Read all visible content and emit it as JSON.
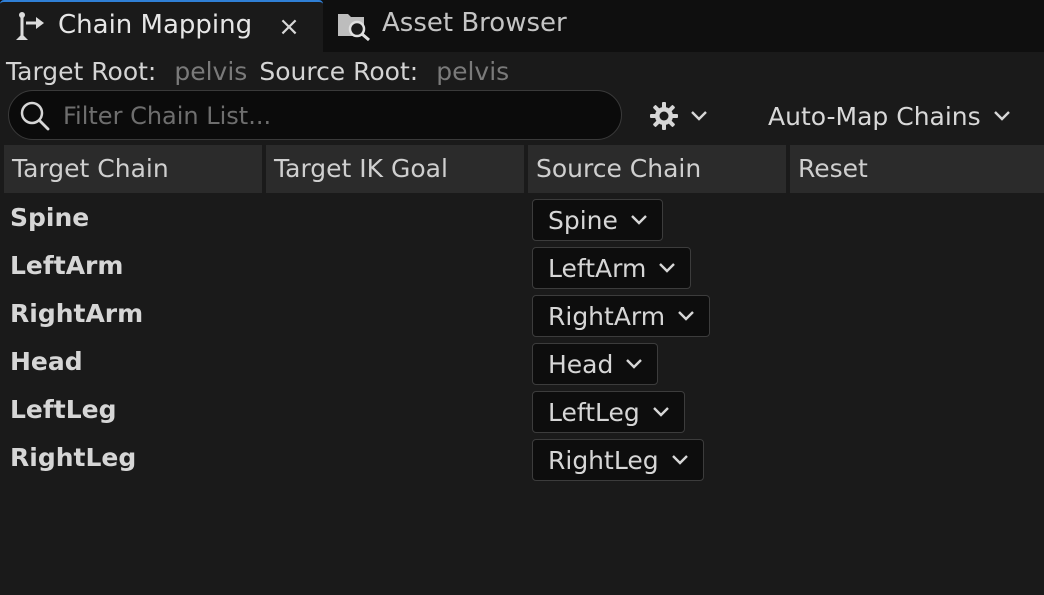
{
  "tabs": {
    "chain_mapping": {
      "label": "Chain Mapping",
      "close": "×"
    },
    "asset_browser": {
      "label": "Asset Browser"
    }
  },
  "roots": {
    "target_label": "Target Root:",
    "target_value": "pelvis",
    "source_label": "Source Root:",
    "source_value": "pelvis"
  },
  "search": {
    "placeholder": "Filter Chain List..."
  },
  "toolbar": {
    "automap_label": "Auto-Map Chains"
  },
  "table": {
    "columns": [
      "Target Chain",
      "Target IK Goal",
      "Source Chain",
      "Reset"
    ],
    "rows": [
      {
        "target": "Spine",
        "source": "Spine"
      },
      {
        "target": "LeftArm",
        "source": "LeftArm"
      },
      {
        "target": "RightArm",
        "source": "RightArm"
      },
      {
        "target": "Head",
        "source": "Head"
      },
      {
        "target": "LeftLeg",
        "source": "LeftLeg"
      },
      {
        "target": "RightLeg",
        "source": "RightLeg"
      }
    ]
  },
  "colors": {
    "accent": "#2f7fd6",
    "background": "#1a1a1a",
    "header": "#2b2b2b"
  }
}
